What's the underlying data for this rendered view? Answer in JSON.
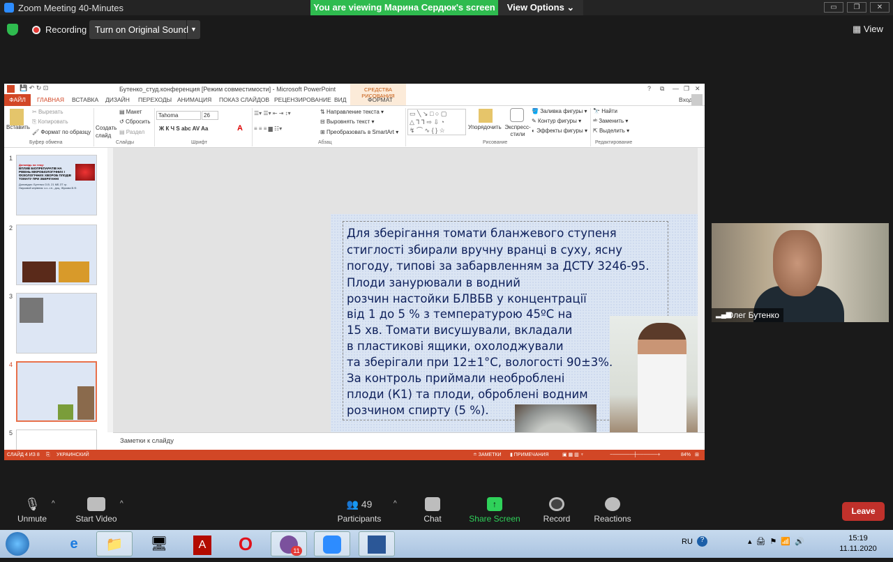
{
  "zoom": {
    "title": "Zoom Meeting 40-Minutes",
    "banner": "You are viewing Марина Сердюк's screen",
    "view_options": "View Options ⌄",
    "recording": "Recording",
    "original_sound": "Turn on Original Sound",
    "view": "View",
    "win_buttons": [
      "▭",
      "❐",
      "✕"
    ]
  },
  "ppt": {
    "title": "Бутенко_студ.конференция [Режим совместимости] - Microsoft PowerPoint",
    "window_controls": [
      "?",
      "⧉",
      "—",
      "❐",
      "✕"
    ],
    "signin": "Вход",
    "contextual_group": "СРЕДСТВА РИСОВАНИЯ",
    "tabs": [
      "ФАЙЛ",
      "ГЛАВНАЯ",
      "ВСТАВКА",
      "ДИЗАЙН",
      "ПЕРЕХОДЫ",
      "АНИМАЦИЯ",
      "ПОКАЗ СЛАЙДОВ",
      "РЕЦЕНЗИРОВАНИЕ",
      "ВИД",
      "ФОРМАТ"
    ],
    "ribbon": {
      "paste": "Вставить",
      "cut": "Вырезать",
      "copy": "Копировать",
      "format_painter": "Формат по образцу",
      "clipboard": "Буфер обмена",
      "new_slide": "Создать слайд",
      "layout": "Макет",
      "reset": "Сбросить",
      "section": "Раздел",
      "slides": "Слайды",
      "font_name": "Tahoma",
      "font_size": "26",
      "font_styles": "Ж  К  Ч  S  abc  AV  Aa",
      "font": "Шрифт",
      "text_direction": "Направление текста",
      "align_text": "Выровнять текст",
      "smartart": "Преобразовать в SmartArt",
      "paragraph": "Абзац",
      "arrange": "Упорядочить",
      "quick_styles": "Экспресс-стили",
      "shape_fill": "Заливка фигуры",
      "shape_outline": "Контур фигуры",
      "shape_effects": "Эффекты фигуры",
      "drawing": "Рисование",
      "find": "Найти",
      "replace": "Заменить",
      "select": "Выделить",
      "editing": "Редактирование"
    },
    "thumbnails": [
      {
        "num": "1",
        "heading": "Доповідь на тему:",
        "title": "ВПЛИВ БІОПРЕПАРАТІВ НА РІВЕНЬ МІКРОБІОЛОГІЧНИХ І ФІЗІОЛОГІЧНИХ ХВОРОБ ПЛОДІВ ТОМАТУ ПРИ ЗБЕРІГАННІ",
        "author": "Доповідач: Бутенко О.В. 21 МБ ЗТ гр.",
        "advisor": "Науковий керівник: к.с.-г.н., доц. Жукова В.Ф."
      },
      {
        "num": "2"
      },
      {
        "num": "3"
      },
      {
        "num": "4"
      },
      {
        "num": "5"
      }
    ],
    "slide_lines": [
      "    Для  зберігання  томати  бланжевого  ступеня",
      "стиглості  збирали  вручну  вранці  в  суху,  ясну",
      "погоду, типові за забарвленням за ДСТУ 3246-95.",
      "    Плоди занурювали в водний",
      "розчин настойки БЛВБВ у концентрації",
      "від 1 до 5 % з температурою 45ºС на",
      "15 хв. Томати висушували, вкладали",
      "в пластикові ящики, охолоджували",
      "та зберігали при 12±1°С, вологості 90±3%.",
      "     За контроль приймали необроблені",
      "плоди (К1) та плоди, оброблені водним",
      "розчином спирту (5 %)."
    ],
    "notes_placeholder": "Заметки к слайду",
    "status": {
      "slide": "СЛАЙД 4 ИЗ 8",
      "language": "УКРАИНСКИЙ",
      "notes": "≐ ЗАМЕТКИ",
      "comments": "▮ ПРИМЕЧАНИЯ",
      "zoom": "84%"
    }
  },
  "video": {
    "name": "Олег Бутенко"
  },
  "toolbar": {
    "unmute": "Unmute",
    "start_video": "Start Video",
    "participants": "Participants",
    "participants_count": "49",
    "chat": "Chat",
    "share": "Share Screen",
    "record": "Record",
    "reactions": "Reactions",
    "leave": "Leave"
  },
  "taskbar": {
    "lang": "RU",
    "time": "15:19",
    "date": "11.11.2020",
    "viber_badge": "11"
  },
  "colors": {
    "ppt_accent": "#d24726",
    "zoom_green": "#2fbb4f",
    "leave": "#c0312b"
  }
}
